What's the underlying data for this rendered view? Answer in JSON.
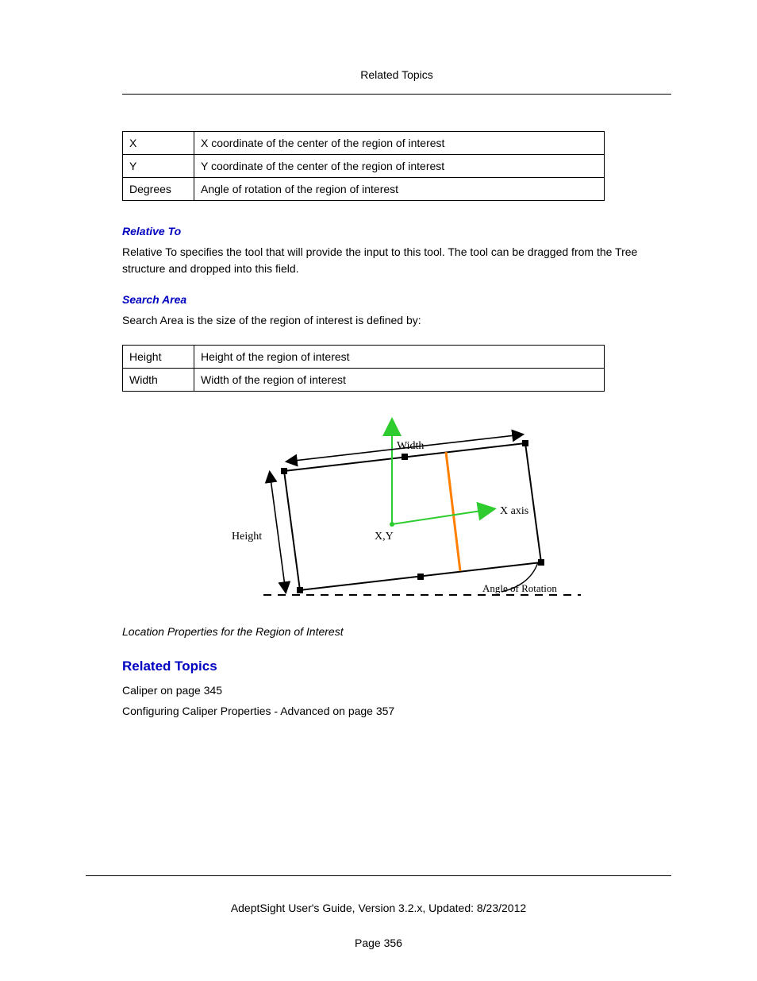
{
  "header": {
    "title": "Related Topics"
  },
  "table1": {
    "rows": [
      {
        "k": "X",
        "v": "X coordinate of the center of the region of interest"
      },
      {
        "k": "Y",
        "v": "Y coordinate of the center of the region of interest"
      },
      {
        "k": "Degrees",
        "v": "Angle of rotation of the region of interest"
      }
    ]
  },
  "relative": {
    "heading": "Relative To",
    "text": "Relative To specifies the tool that will provide the input to this tool. The tool can be dragged from the Tree structure and dropped into this field."
  },
  "search": {
    "heading": "Search Area",
    "text": "Search Area is the size of the region of interest is defined by:",
    "rows": [
      {
        "k": "Height",
        "v": "Height of the region of interest"
      },
      {
        "k": "Width",
        "v": "Width of the region of interest"
      }
    ]
  },
  "figure": {
    "labels": {
      "width": "Width",
      "height": "Height",
      "xy": "X,Y",
      "xaxis": "X axis",
      "angle": "Angle of Rotation"
    },
    "caption": "Location Properties for the Region of Interest"
  },
  "related": {
    "heading": "Related Topics",
    "links": [
      "Caliper on page 345",
      "Configuring Caliper Properties - Advanced on page 357"
    ]
  },
  "footer": {
    "line": "AdeptSight User's Guide,  Version 3.2.x, Updated: 8/23/2012",
    "page": "Page 356"
  }
}
